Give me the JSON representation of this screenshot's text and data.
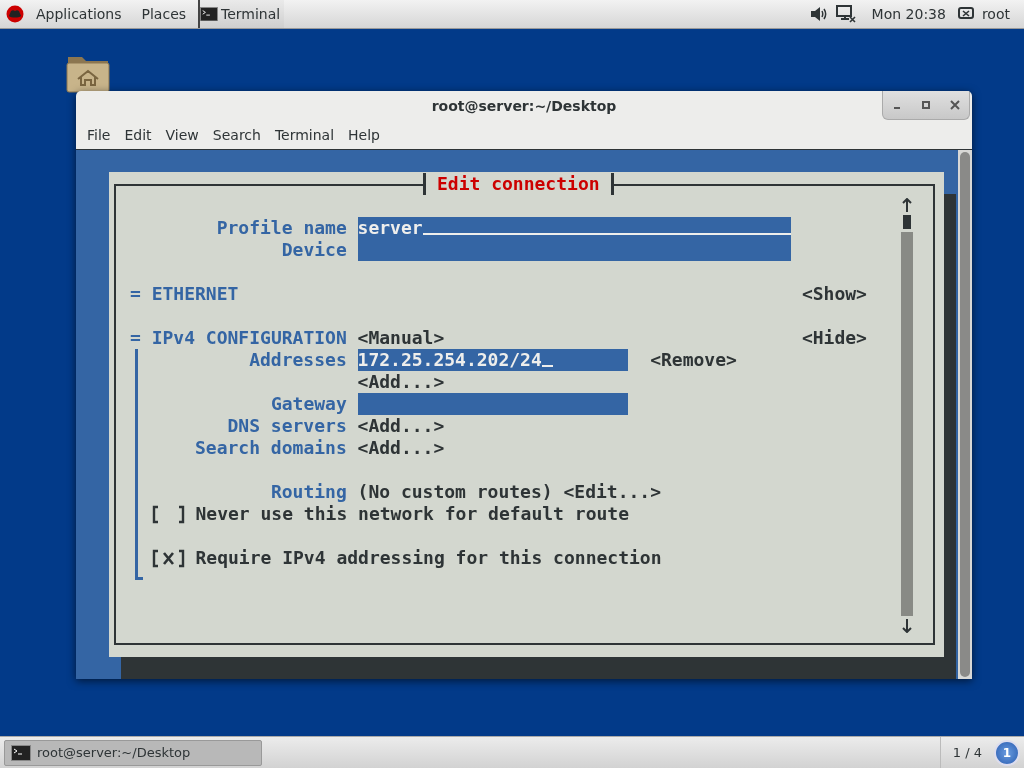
{
  "top_bar": {
    "menus": [
      "Applications",
      "Places"
    ],
    "task": "Terminal",
    "clock": "Mon 20:38",
    "user": "root"
  },
  "window": {
    "title": "root@server:~/Desktop",
    "menu": [
      "File",
      "Edit",
      "View",
      "Search",
      "Terminal",
      "Help"
    ]
  },
  "dialog": {
    "title": "Edit connection",
    "fields": [
      {
        "label": "Profile name",
        "value": "server",
        "underlined": true
      },
      {
        "label": "Device"
      }
    ],
    "sections": [
      {
        "title": "= ETHERNET",
        "toggle": "<Show>"
      },
      {
        "title": "= IPv4 CONFIGURATION",
        "mode": "<Manual>",
        "toggle": "<Hide>",
        "rows": [
          {
            "kind": "field",
            "label": "Addresses",
            "value": "172.25.254.202/24",
            "cursor": true,
            "action": "<Remove>"
          },
          {
            "kind": "button",
            "action": "<Add...>"
          },
          {
            "kind": "field",
            "label": "Gateway"
          },
          {
            "kind": "button",
            "label": "DNS servers",
            "action": "<Add...>"
          },
          {
            "kind": "button",
            "label": "Search domains",
            "action": "<Add...>"
          },
          {
            "kind": "routing",
            "label": "Routing",
            "value": "(No custom routes)",
            "action": "<Edit...>"
          },
          {
            "kind": "checkbox",
            "checked": false,
            "text": "Never use this network for default route"
          },
          {
            "kind": "checkbox",
            "checked": true,
            "text": "Require IPv4 addressing for this connection"
          }
        ]
      }
    ]
  },
  "taskbar": {
    "task": "root@server:~/Desktop",
    "workspace": "1 / 4",
    "badge": "1"
  }
}
